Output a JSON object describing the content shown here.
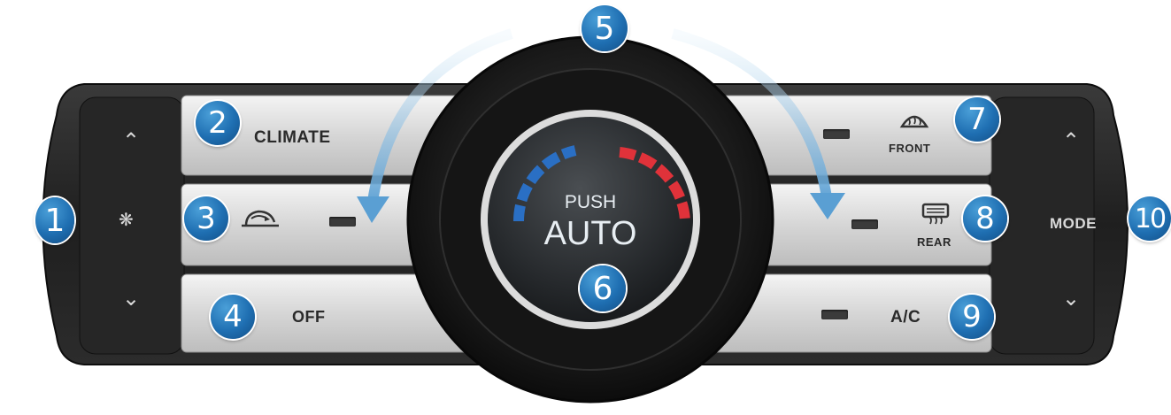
{
  "buttons": {
    "climate": "CLIMATE",
    "off": "OFF",
    "front": "FRONT",
    "rear": "REAR",
    "ac": "A/C",
    "mode": "MODE"
  },
  "knob": {
    "push": "PUSH",
    "auto": "AUTO"
  },
  "callouts": [
    "1",
    "2",
    "3",
    "4",
    "5",
    "6",
    "7",
    "8",
    "9",
    "10"
  ],
  "icons": {
    "fan": "fan-icon",
    "recirculation": "air-recirculation-icon",
    "front_defrost": "front-defrost-icon",
    "rear_defrost": "rear-defrost-icon",
    "up": "chevron-up-icon",
    "down": "chevron-down-icon"
  },
  "colors": {
    "callout": "#1f6fb2",
    "cold_scale": "#2a6fc4",
    "hot_scale": "#e0323a",
    "arrow": "#7eb8e0"
  }
}
